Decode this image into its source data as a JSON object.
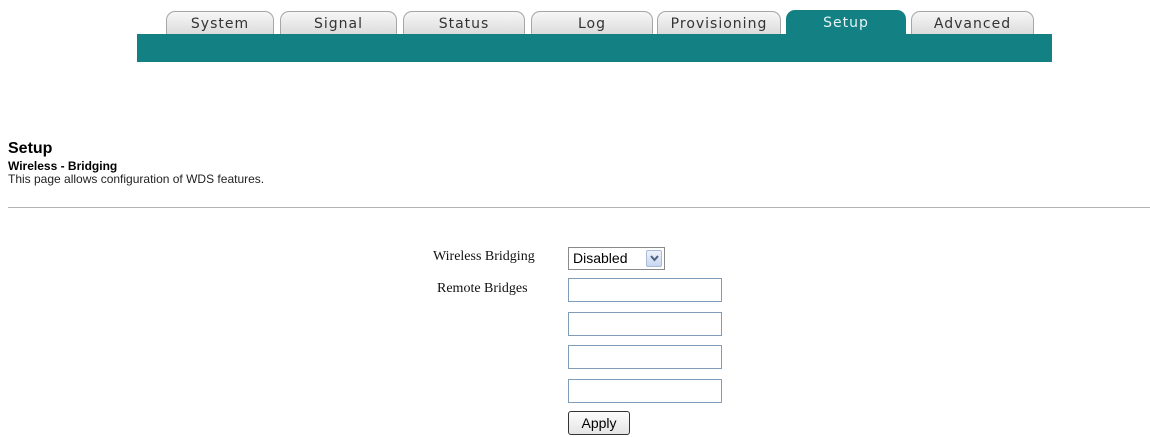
{
  "tabs": [
    {
      "label": "System",
      "active": false
    },
    {
      "label": "Signal",
      "active": false
    },
    {
      "label": "Status",
      "active": false
    },
    {
      "label": "Log",
      "active": false
    },
    {
      "label": "Provisioning",
      "active": false
    },
    {
      "label": "Setup",
      "active": true
    },
    {
      "label": "Advanced",
      "active": false
    }
  ],
  "colors": {
    "accent": "#138184"
  },
  "page": {
    "title": "Setup",
    "subtitle": "Wireless - Bridging",
    "description": "This page allows configuration of WDS features."
  },
  "form": {
    "bridging_label": "Wireless Bridging",
    "bridging_value": "Disabled",
    "remote_label": "Remote Bridges",
    "remote_bridges": [
      "",
      "",
      "",
      ""
    ],
    "apply_label": "Apply"
  },
  "icons": {
    "dropdown": "chevron-down-icon"
  }
}
